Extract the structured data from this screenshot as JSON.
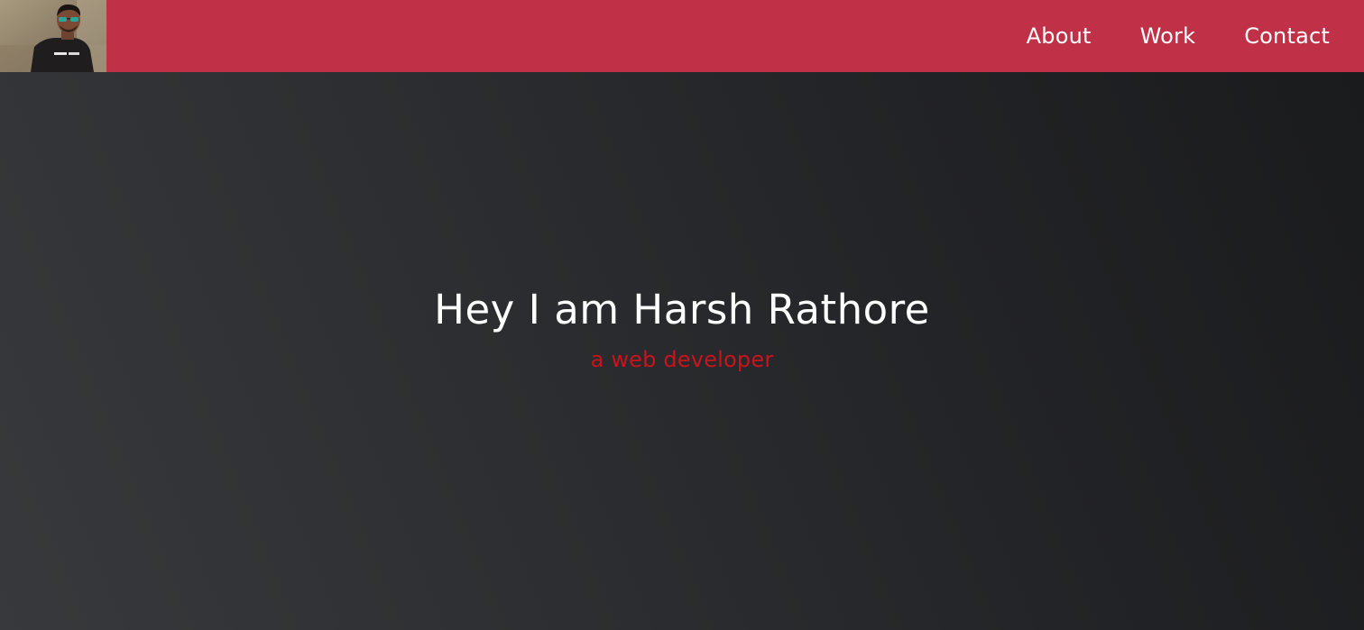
{
  "navbar": {
    "avatar_alt": "Harsh Rathore profile photo",
    "links": [
      {
        "label": "About"
      },
      {
        "label": "Work"
      },
      {
        "label": "Contact"
      }
    ]
  },
  "hero": {
    "title": "Hey I am Harsh Rathore",
    "subtitle": "a web developer"
  },
  "colors": {
    "navbar_bg": "#c03147",
    "hero_bg_dark": "#1a1b1d",
    "hero_bg_light": "#37393c",
    "title_text": "#ffffff",
    "subtitle_text": "#c8141c"
  }
}
